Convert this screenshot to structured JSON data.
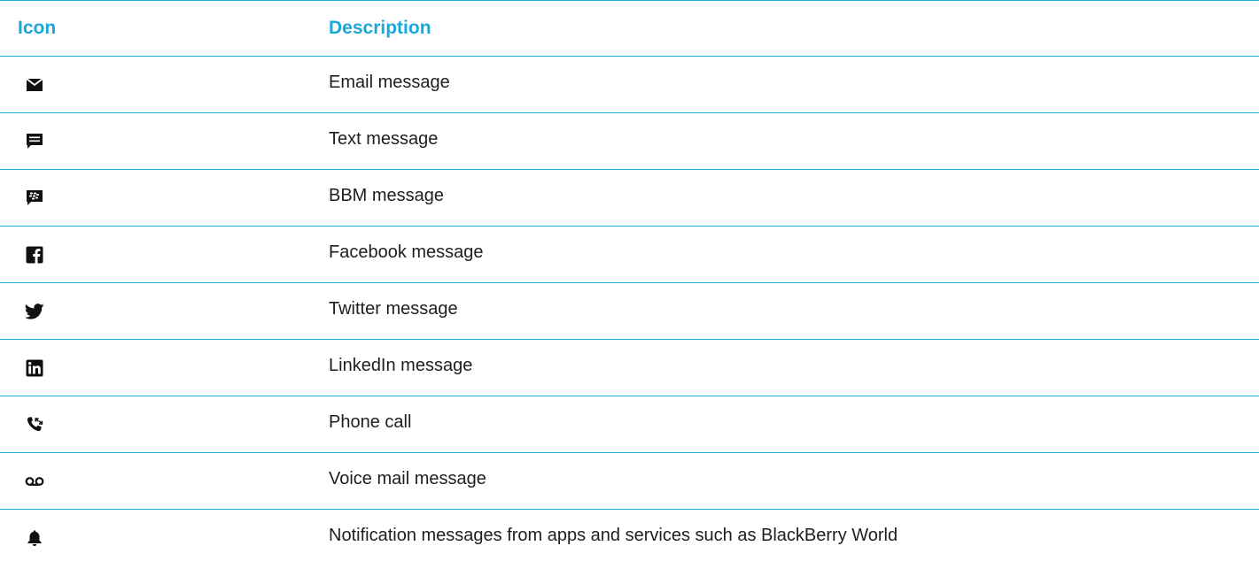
{
  "table": {
    "accent_color": "#1aa7d9",
    "headers": {
      "icon": "Icon",
      "description": "Description"
    },
    "rows": [
      {
        "icon": "envelope-icon",
        "description": "Email message"
      },
      {
        "icon": "text-message-icon",
        "description": "Text message"
      },
      {
        "icon": "bbm-icon",
        "description": "BBM message"
      },
      {
        "icon": "facebook-icon",
        "description": "Facebook message"
      },
      {
        "icon": "twitter-icon",
        "description": "Twitter message"
      },
      {
        "icon": "linkedin-icon",
        "description": "LinkedIn message"
      },
      {
        "icon": "phone-call-icon",
        "description": "Phone call"
      },
      {
        "icon": "voicemail-icon",
        "description": "Voice mail message"
      },
      {
        "icon": "bell-icon",
        "description": "Notification messages from apps and services such as BlackBerry World"
      }
    ]
  }
}
